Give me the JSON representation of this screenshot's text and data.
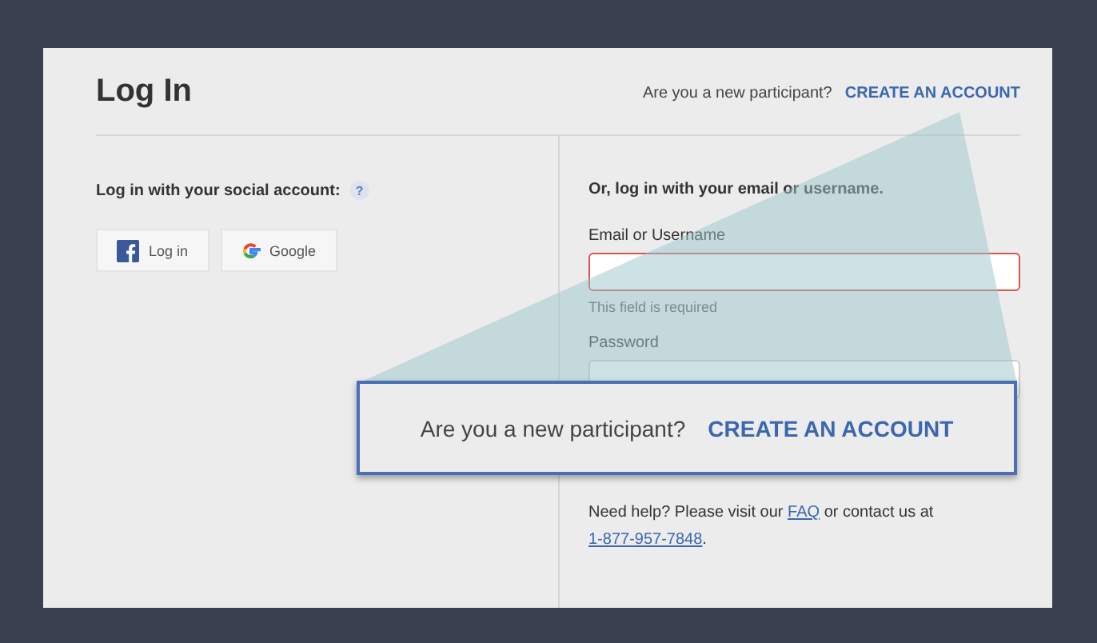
{
  "header": {
    "title": "Log In",
    "prompt": "Are you a new participant?",
    "link": "CREATE AN ACCOUNT"
  },
  "social": {
    "heading": "Log in with your social account:",
    "help_icon": "?",
    "buttons": [
      {
        "kind": "facebook",
        "label": "Log in"
      },
      {
        "kind": "google",
        "label": "Google"
      }
    ]
  },
  "login_form": {
    "heading": "Or, log in with your email or username.",
    "fields": [
      {
        "label": "Email or Username",
        "error": "This field is required"
      },
      {
        "label": "Password"
      }
    ]
  },
  "help": {
    "text_before": "Need help? Please visit our",
    "faq_link": "FAQ",
    "text_after": "or contact us at",
    "phone_link": "1-877-957-7848",
    "end": "."
  },
  "callout": {
    "prompt": "Are you a new participant?",
    "link": "CREATE AN ACCOUNT"
  }
}
